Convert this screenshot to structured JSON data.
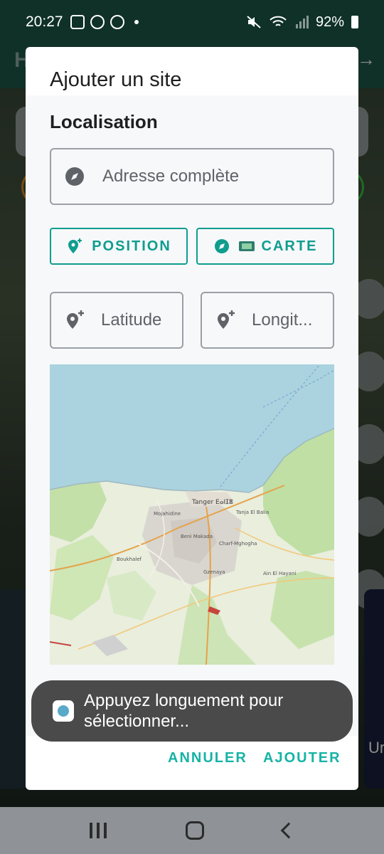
{
  "status_bar": {
    "time": "20:27",
    "battery": "92%"
  },
  "dialog": {
    "title": "Ajouter un site",
    "section_title": "Localisation",
    "address_placeholder": "Adresse complète",
    "position_button": "POSITION",
    "map_button": "CARTE",
    "latitude_placeholder": "Latitude",
    "longitude_placeholder": "Longit...",
    "cancel": "ANNULER",
    "add": "AJOUTER"
  },
  "map": {
    "city_label": "Tanger ⴹⴰⵏⵊⴻ",
    "area_label": "Mojahidine",
    "labels": [
      "Tanger ⴹⴰⵏⵊⴻ",
      "Mojahidine",
      "Beni Makada",
      "Tanja El Balia",
      "Charf-Mghogha",
      "Boukhalef",
      "Gzenaya",
      "Ain El Hayani"
    ]
  },
  "toast": {
    "message": "Appuyez longuement pour sélectionner..."
  },
  "background": {
    "right_card_text": "Ur"
  },
  "colors": {
    "accent": "#16b3a6",
    "outline_accent": "#0f9d8f"
  },
  "icons": [
    "compass-icon",
    "add-location-icon",
    "map-flag-icon"
  ]
}
